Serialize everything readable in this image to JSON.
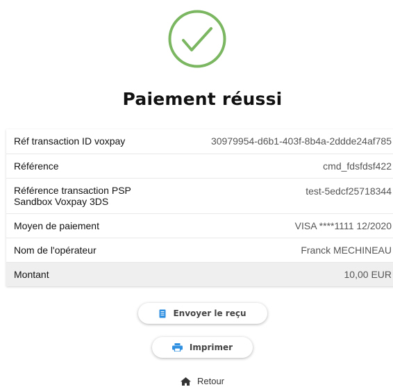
{
  "colors": {
    "success_green": "#7bb661",
    "button_icon_blue": "#2f8fe0",
    "total_row_bg": "#efefef"
  },
  "icons": {
    "success": "check-circle-icon",
    "receipt": "receipt-icon",
    "print": "printer-icon",
    "back": "home-icon"
  },
  "page": {
    "title": "Paiement réussi"
  },
  "details": {
    "rows": [
      {
        "label": "Réf transaction ID voxpay",
        "value": "30979954-d6b1-403f-8b4a-2ddde24af785"
      },
      {
        "label": "Référence",
        "value": "cmd_fdsfdsf422"
      },
      {
        "label_line1": "Référence transaction PSP",
        "label_line2": "Sandbox Voxpay 3DS",
        "value": "test-5edcf25718344"
      },
      {
        "label": "Moyen de paiement",
        "value": "VISA ****1111 12/2020"
      },
      {
        "label": "Nom de l'opérateur",
        "value": "Franck MECHINEAU"
      },
      {
        "label": "Montant",
        "value": "10,00 EUR"
      }
    ]
  },
  "actions": {
    "send_receipt_label": "Envoyer le reçu",
    "print_label": "Imprimer",
    "back_label": "Retour"
  }
}
